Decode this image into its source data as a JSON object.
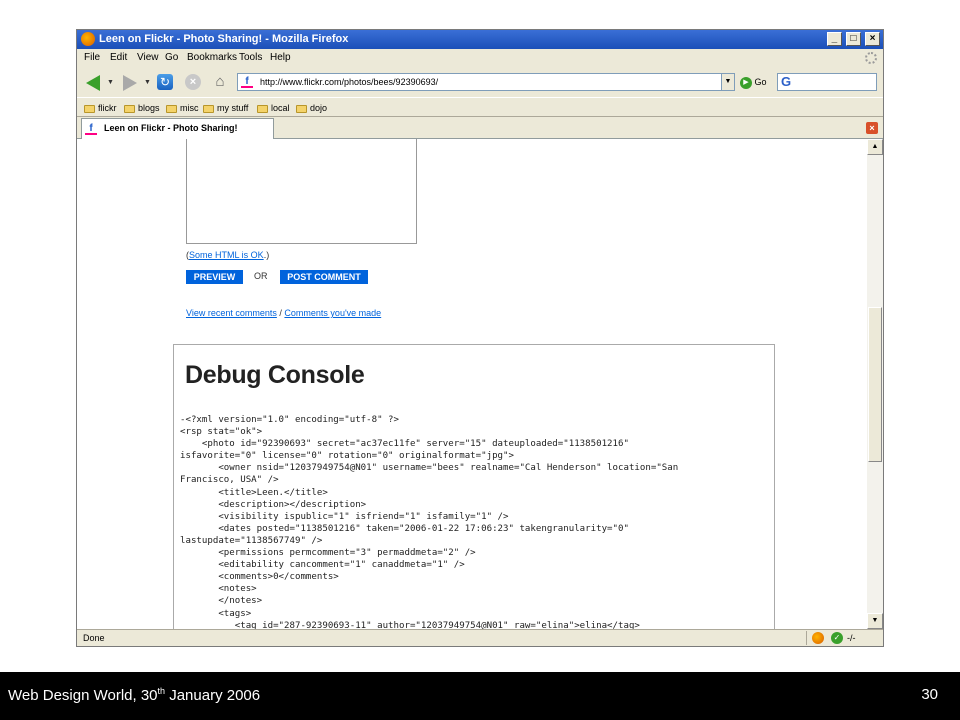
{
  "window": {
    "title": "Leen on Flickr - Photo Sharing! - Mozilla Firefox",
    "controls": [
      "_",
      "□",
      "×"
    ]
  },
  "menu": [
    "File",
    "Edit",
    "View",
    "Go",
    "Bookmarks",
    "Tools",
    "Help"
  ],
  "navbar": {
    "url": "http://www.flickr.com/photos/bees/92390693/",
    "go_label": "Go",
    "favicon": "f"
  },
  "bookmarks": [
    "flickr",
    "blogs",
    "misc",
    "my stuff",
    "local",
    "dojo"
  ],
  "tab": {
    "title": "Leen on Flickr - Photo Sharing!"
  },
  "page": {
    "help_prefix": "(",
    "help_link": "Some HTML is OK",
    "help_suffix": ".)",
    "preview_label": "PREVIEW",
    "or_label": "OR",
    "post_label": "POST COMMENT",
    "recent_comments_link": "View recent comments",
    "separator": "/",
    "my_comments_link": "Comments you've made"
  },
  "debug": {
    "title": "Debug Console",
    "code_lines": [
      "-<?xml version=\"1.0\" encoding=\"utf-8\" ?>",
      "<rsp stat=\"ok\">",
      "    <photo id=\"92390693\" secret=\"ac37ec11fe\" server=\"15\" dateuploaded=\"1138501216\"",
      "isfavorite=\"0\" license=\"0\" rotation=\"0\" originalformat=\"jpg\">",
      "       <owner nsid=\"12037949754@N01\" username=\"bees\" realname=\"Cal Henderson\" location=\"San",
      "Francisco, USA\" />",
      "       <title>Leen.</title>",
      "       <description></description>",
      "       <visibility ispublic=\"1\" isfriend=\"1\" isfamily=\"1\" />",
      "       <dates posted=\"1138501216\" taken=\"2006-01-22 17:06:23\" takengranularity=\"0\"",
      "lastupdate=\"1138567749\" />",
      "       <permissions permcomment=\"3\" permaddmeta=\"2\" />",
      "       <editability cancomment=\"1\" canaddmeta=\"1\" />",
      "       <comments>0</comments>",
      "       <notes>",
      "       </notes>",
      "       <tags>",
      "          <tag id=\"287-92390693-11\" author=\"12037949754@N01\" raw=\"elina\">elina</tag>"
    ]
  },
  "status": {
    "text": "Done",
    "zoom": "-/-"
  },
  "footer": {
    "left_prefix": "Web Design World, 30",
    "left_sup": "th",
    "left_suffix": " January 2006",
    "page_number": "30"
  }
}
